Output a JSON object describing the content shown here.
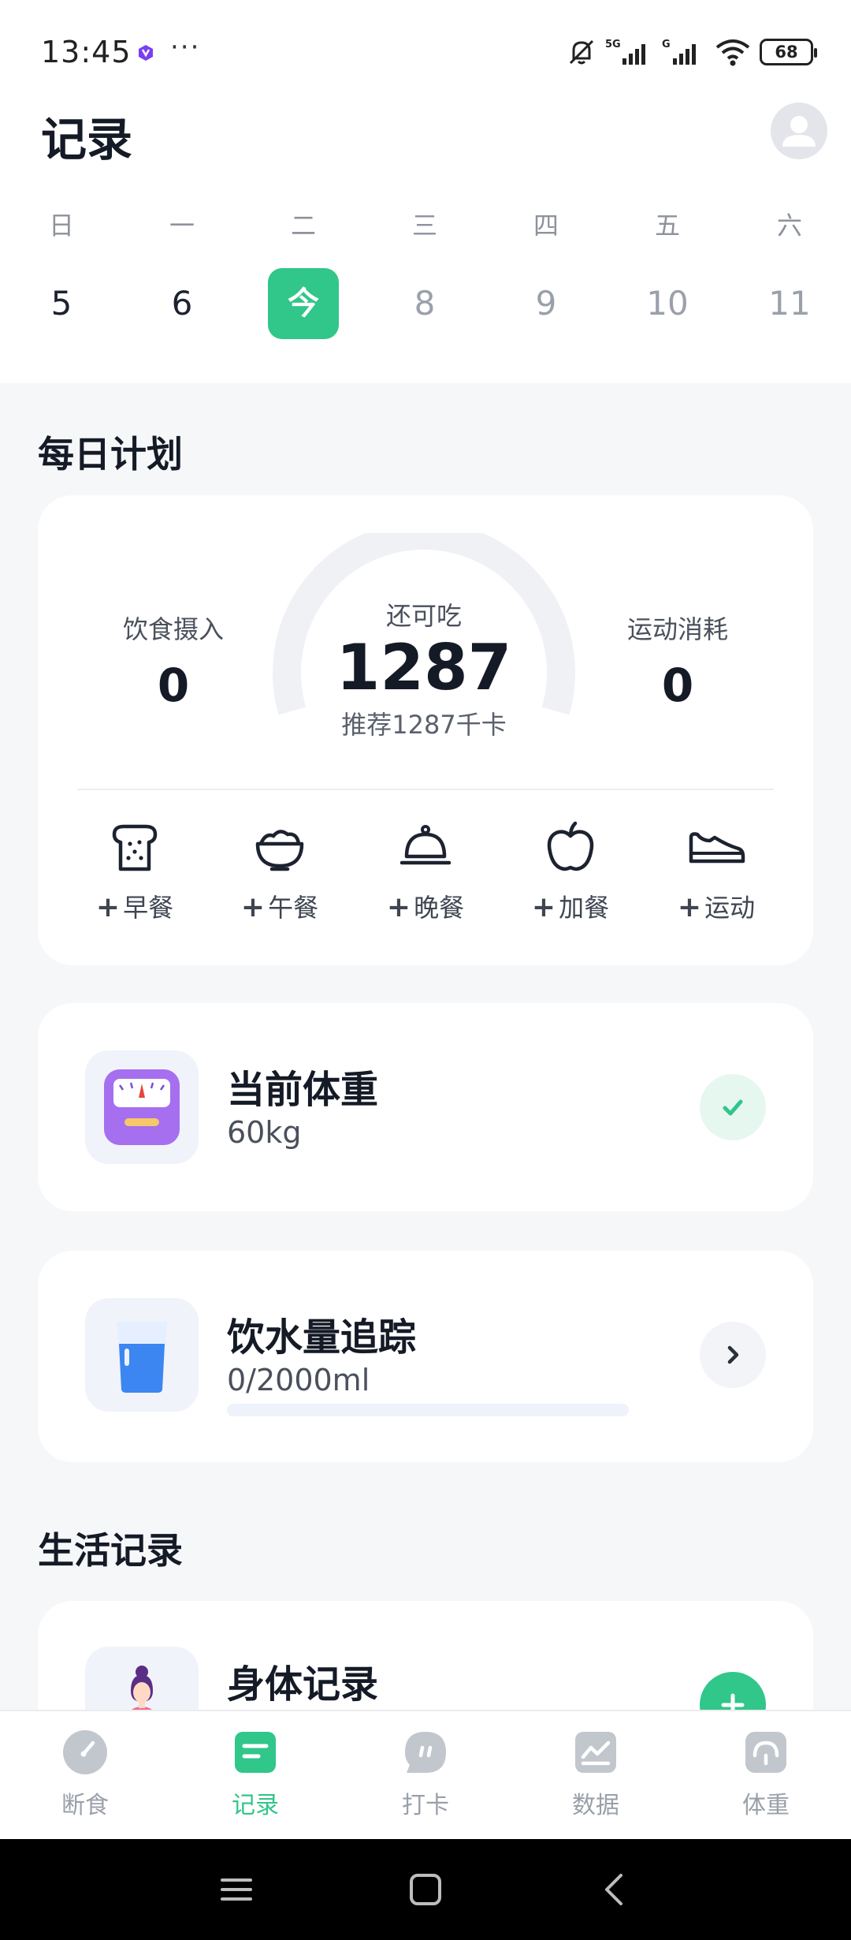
{
  "status_bar": {
    "time": "13:45",
    "more": "···",
    "network_1": "5G",
    "network_2": "G",
    "battery": "68",
    "icons": [
      "app-notification-icon",
      "mute-bell-icon",
      "signal-icon",
      "wifi-icon",
      "battery-icon"
    ]
  },
  "header": {
    "title": "记录",
    "avatar_icon": "user-avatar-icon"
  },
  "calendar": {
    "days": [
      {
        "weekday": "日",
        "date": "5",
        "state": "past"
      },
      {
        "weekday": "一",
        "date": "6",
        "state": "past"
      },
      {
        "weekday": "二",
        "date": "今",
        "state": "today"
      },
      {
        "weekday": "三",
        "date": "8",
        "state": "future"
      },
      {
        "weekday": "四",
        "date": "9",
        "state": "future"
      },
      {
        "weekday": "五",
        "date": "10",
        "state": "future"
      },
      {
        "weekday": "六",
        "date": "11",
        "state": "future"
      }
    ]
  },
  "daily_plan": {
    "section_title": "每日计划",
    "intake_label": "饮食摄入",
    "intake_value": "0",
    "remaining_label": "还可吃",
    "remaining_value": "1287",
    "recommended": "推荐1287千卡",
    "burn_label": "运动消耗",
    "burn_value": "0",
    "gauge_progress": 0,
    "actions": [
      {
        "plus": "+",
        "label": "早餐",
        "icon": "toast-icon"
      },
      {
        "plus": "+",
        "label": "午餐",
        "icon": "bowl-icon"
      },
      {
        "plus": "+",
        "label": "晚餐",
        "icon": "cloche-icon"
      },
      {
        "plus": "+",
        "label": "加餐",
        "icon": "apple-icon"
      },
      {
        "plus": "+",
        "label": "运动",
        "icon": "sneaker-icon"
      }
    ]
  },
  "weight": {
    "title": "当前体重",
    "value": "60kg",
    "icon": "scale-icon",
    "status_icon": "check-icon"
  },
  "water": {
    "title": "饮水量追踪",
    "value": "0/2000ml",
    "progress": 0,
    "icon": "water-glass-icon",
    "action_icon": "chevron-right-icon"
  },
  "life": {
    "section_title": "生活记录",
    "body_title": "身体记录",
    "body_icon": "person-icon",
    "add_icon": "plus-icon"
  },
  "tabs": [
    {
      "label": "断食",
      "icon": "gauge-icon",
      "active": false
    },
    {
      "label": "记录",
      "icon": "note-icon",
      "active": true
    },
    {
      "label": "打卡",
      "icon": "chat-bubble-icon",
      "active": false
    },
    {
      "label": "数据",
      "icon": "trend-chart-icon",
      "active": false
    },
    {
      "label": "体重",
      "icon": "scale-icon",
      "active": false
    }
  ],
  "colors": {
    "accent": "#31c68a",
    "water": "#3b86f0",
    "text": "#141a26",
    "muted": "#9aa0aa"
  }
}
